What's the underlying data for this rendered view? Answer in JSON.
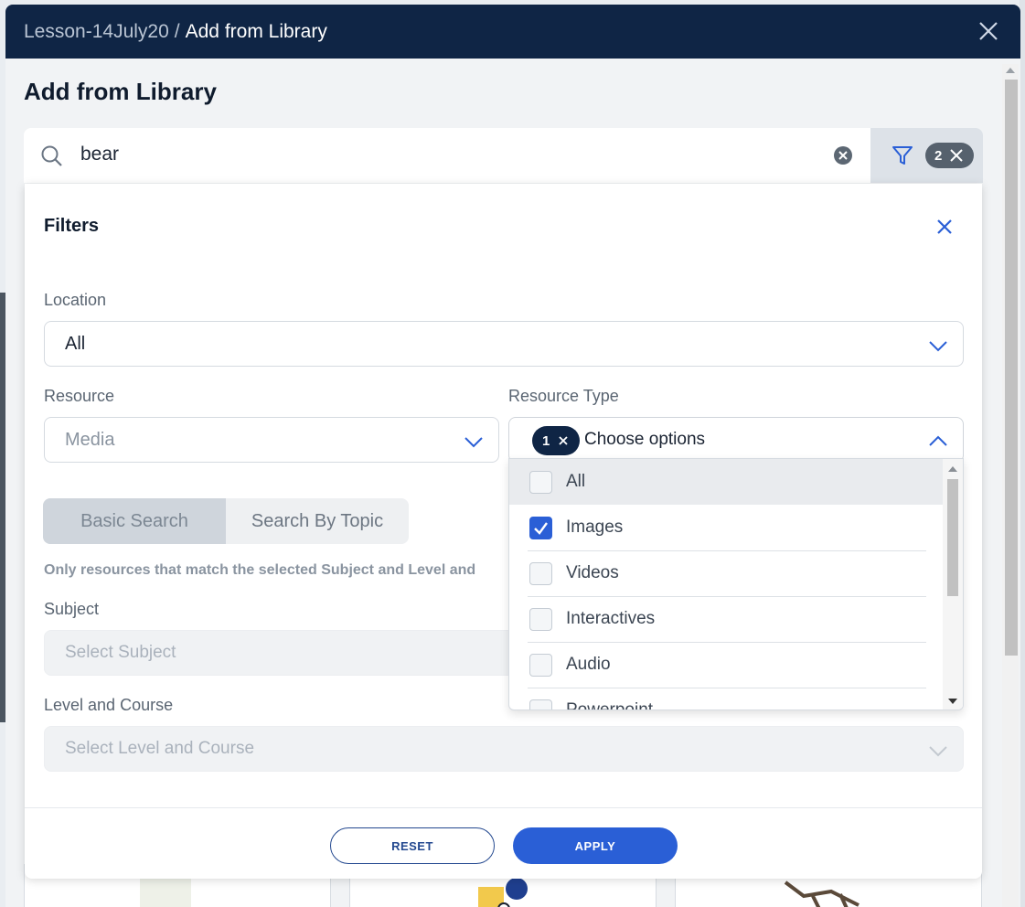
{
  "header": {
    "breadcrumb_parent": "Lesson-14July20",
    "breadcrumb_sep": "/",
    "breadcrumb_current": "Add from Library"
  },
  "page_title": "Add from Library",
  "search": {
    "value": "bear",
    "filter_count": "2"
  },
  "filters": {
    "title": "Filters",
    "location_label": "Location",
    "location_value": "All",
    "resource_label": "Resource",
    "resource_value": "Media",
    "resource_type_label": "Resource Type",
    "resource_type_chip": "1",
    "resource_type_placeholder": "Choose options",
    "tabs": [
      {
        "label": "Basic Search",
        "active": true
      },
      {
        "label": "Search By Topic",
        "active": false
      }
    ],
    "note": "Only resources that match the selected Subject and Level and",
    "subject_label": "Subject",
    "subject_placeholder": "Select Subject",
    "level_label": "Level and Course",
    "level_placeholder": "Select Level and Course",
    "reset_label": "RESET",
    "apply_label": "APPLY"
  },
  "resource_type_options": [
    {
      "label": "All",
      "checked": false
    },
    {
      "label": "Images",
      "checked": true
    },
    {
      "label": "Videos",
      "checked": false
    },
    {
      "label": "Interactives",
      "checked": false
    },
    {
      "label": "Audio",
      "checked": false
    },
    {
      "label": "Powerpoint",
      "checked": false
    }
  ],
  "colors": {
    "header_bg": "#0f2545",
    "accent": "#2a5fd6"
  }
}
